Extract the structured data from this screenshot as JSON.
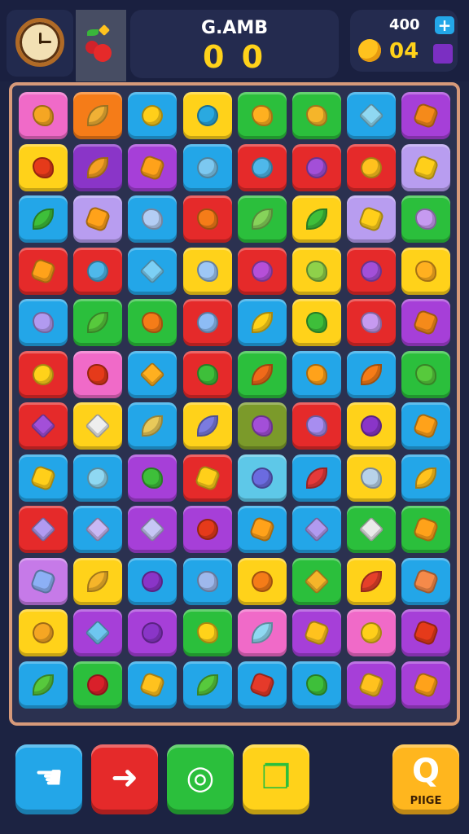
{
  "header": {
    "title": "G.AMB",
    "score": "0 0",
    "coins": "400",
    "plus": "+",
    "gems": "04"
  },
  "icons": {
    "clock": "clock-icon",
    "powerup": "cherries-icon",
    "coin": "coin-icon",
    "gem": "gem-icon"
  },
  "board": {
    "rows": [
      [
        {
          "bg": "#f06ac8",
          "fg": "#f5a623",
          "shape": "blob"
        },
        {
          "bg": "#f57c18",
          "fg": "#f0b035",
          "shape": "leaf"
        },
        {
          "bg": "#23a6e8",
          "fg": "#ffcf1a",
          "shape": "circle"
        },
        {
          "bg": "#ffd21a",
          "fg": "#2aa9e0",
          "shape": "circle"
        },
        {
          "bg": "#2bbf3c",
          "fg": "#ffb020",
          "shape": "blob"
        },
        {
          "bg": "#2bbf3c",
          "fg": "#f5b52a",
          "shape": "blob"
        },
        {
          "bg": "#23a6e8",
          "fg": "#8fd8f2",
          "shape": "diamond"
        },
        {
          "bg": "#a63fd8",
          "fg": "#f58a1a",
          "shape": "star"
        }
      ],
      [
        {
          "bg": "#ffd21a",
          "fg": "#e53a1a",
          "shape": "blob"
        },
        {
          "bg": "#8a35c8",
          "fg": "#f5a023",
          "shape": "leaf"
        },
        {
          "bg": "#a63fd8",
          "fg": "#ffa21a",
          "shape": "star"
        },
        {
          "bg": "#23a6e8",
          "fg": "#7cc8f0",
          "shape": "circle"
        },
        {
          "bg": "#e52a2a",
          "fg": "#4fb8ea",
          "shape": "circle"
        },
        {
          "bg": "#e52a2a",
          "fg": "#a34fd8",
          "shape": "circle"
        },
        {
          "bg": "#e52a2a",
          "fg": "#ffc21e",
          "shape": "circle"
        },
        {
          "bg": "#b89df0",
          "fg": "#ffcf1a",
          "shape": "star"
        }
      ],
      [
        {
          "bg": "#23a6e8",
          "fg": "#3ebf3a",
          "shape": "leaf"
        },
        {
          "bg": "#b89df0",
          "fg": "#ffa21a",
          "shape": "star"
        },
        {
          "bg": "#23a6e8",
          "fg": "#b3cdf5",
          "shape": "blob"
        },
        {
          "bg": "#e52a2a",
          "fg": "#f57c18",
          "shape": "blob"
        },
        {
          "bg": "#2bbf3c",
          "fg": "#86d35a",
          "shape": "leaf"
        },
        {
          "bg": "#ffd21a",
          "fg": "#3ebf3a",
          "shape": "leaf"
        },
        {
          "bg": "#b89df0",
          "fg": "#ffcf1a",
          "shape": "star"
        },
        {
          "bg": "#2bbf3c",
          "fg": "#c69af0",
          "shape": "blob"
        }
      ],
      [
        {
          "bg": "#e52a2a",
          "fg": "#ffa21a",
          "shape": "star"
        },
        {
          "bg": "#e52a2a",
          "fg": "#4fb8ea",
          "shape": "circle"
        },
        {
          "bg": "#23a6e8",
          "fg": "#7cd0f5",
          "shape": "diamond"
        },
        {
          "bg": "#ffd21a",
          "fg": "#9ec7f5",
          "shape": "blob"
        },
        {
          "bg": "#e52a2a",
          "fg": "#b64fd8",
          "shape": "circle"
        },
        {
          "bg": "#ffd21a",
          "fg": "#8fd14a",
          "shape": "blob"
        },
        {
          "bg": "#e52a2a",
          "fg": "#a34fd8",
          "shape": "circle"
        },
        {
          "bg": "#ffd21a",
          "fg": "#ffb020",
          "shape": "blob"
        }
      ],
      [
        {
          "bg": "#23a6e8",
          "fg": "#b19af0",
          "shape": "blob"
        },
        {
          "bg": "#2bbf3c",
          "fg": "#57c93c",
          "shape": "leaf"
        },
        {
          "bg": "#2bbf3c",
          "fg": "#f57c18",
          "shape": "blob"
        },
        {
          "bg": "#e52a2a",
          "fg": "#8dbcf5",
          "shape": "circle"
        },
        {
          "bg": "#23a6e8",
          "fg": "#ffd21a",
          "shape": "leaf"
        },
        {
          "bg": "#ffd21a",
          "fg": "#3ebf3a",
          "shape": "blob"
        },
        {
          "bg": "#e52a2a",
          "fg": "#c69af0",
          "shape": "blob"
        },
        {
          "bg": "#a63fd8",
          "fg": "#f58a1a",
          "shape": "star"
        }
      ],
      [
        {
          "bg": "#e52a2a",
          "fg": "#ffd21a",
          "shape": "circle"
        },
        {
          "bg": "#f06ac8",
          "fg": "#e53a1a",
          "shape": "blob"
        },
        {
          "bg": "#23a6e8",
          "fg": "#ffb020",
          "shape": "diamond"
        },
        {
          "bg": "#e52a2a",
          "fg": "#3ebf3a",
          "shape": "blob"
        },
        {
          "bg": "#2bbf3c",
          "fg": "#f06a1a",
          "shape": "leaf"
        },
        {
          "bg": "#23a6e8",
          "fg": "#ffa21a",
          "shape": "blob"
        },
        {
          "bg": "#23a6e8",
          "fg": "#f57c18",
          "shape": "leaf"
        },
        {
          "bg": "#2bbf3c",
          "fg": "#57c93c",
          "shape": "blob"
        }
      ],
      [
        {
          "bg": "#e52a2a",
          "fg": "#a34fd8",
          "shape": "diamond"
        },
        {
          "bg": "#ffd21a",
          "fg": "#eeeeee",
          "shape": "diamond"
        },
        {
          "bg": "#23a6e8",
          "fg": "#e8c95a",
          "shape": "leaf"
        },
        {
          "bg": "#ffd21a",
          "fg": "#7b7be0",
          "shape": "leaf"
        },
        {
          "bg": "#7b9a2a",
          "fg": "#a34fd8",
          "shape": "blob"
        },
        {
          "bg": "#e52a2a",
          "fg": "#a78df0",
          "shape": "blob"
        },
        {
          "bg": "#ffd21a",
          "fg": "#8a35c8",
          "shape": "circle"
        },
        {
          "bg": "#23a6e8",
          "fg": "#ffa21a",
          "shape": "star"
        }
      ],
      [
        {
          "bg": "#23a6e8",
          "fg": "#ffcf1a",
          "shape": "star"
        },
        {
          "bg": "#23a6e8",
          "fg": "#8fd8f2",
          "shape": "circle"
        },
        {
          "bg": "#a63fd8",
          "fg": "#3ebf3a",
          "shape": "blob"
        },
        {
          "bg": "#e52a2a",
          "fg": "#ffcf1a",
          "shape": "star"
        },
        {
          "bg": "#5ec8e8",
          "fg": "#6b6be0",
          "shape": "circle"
        },
        {
          "bg": "#23a6e8",
          "fg": "#e53a3a",
          "shape": "leaf"
        },
        {
          "bg": "#ffd21a",
          "fg": "#b8d2e8",
          "shape": "blob"
        },
        {
          "bg": "#23a6e8",
          "fg": "#ffc21e",
          "shape": "leaf"
        }
      ],
      [
        {
          "bg": "#e52a2a",
          "fg": "#b19af0",
          "shape": "diamond"
        },
        {
          "bg": "#23a6e8",
          "fg": "#c9b8f5",
          "shape": "diamond"
        },
        {
          "bg": "#a63fd8",
          "fg": "#c6c6f5",
          "shape": "diamond"
        },
        {
          "bg": "#a63fd8",
          "fg": "#e53a1a",
          "shape": "circle"
        },
        {
          "bg": "#23a6e8",
          "fg": "#ffa21a",
          "shape": "star"
        },
        {
          "bg": "#23a6e8",
          "fg": "#b19af0",
          "shape": "diamond"
        },
        {
          "bg": "#2bbf3c",
          "fg": "#eaeaea",
          "shape": "diamond"
        },
        {
          "bg": "#2bbf3c",
          "fg": "#ffa21a",
          "shape": "star"
        }
      ],
      [
        {
          "bg": "#c67ae8",
          "fg": "#8cb0f5",
          "shape": "star"
        },
        {
          "bg": "#ffd21a",
          "fg": "#f5b52a",
          "shape": "leaf"
        },
        {
          "bg": "#23a6e8",
          "fg": "#8a35c8",
          "shape": "circle"
        },
        {
          "bg": "#23a6e8",
          "fg": "#9eb8ec",
          "shape": "blob"
        },
        {
          "bg": "#ffd21a",
          "fg": "#f57c18",
          "shape": "circle"
        },
        {
          "bg": "#2bbf3c",
          "fg": "#f5b52a",
          "shape": "diamond"
        },
        {
          "bg": "#ffd21a",
          "fg": "#e5402a",
          "shape": "leaf"
        },
        {
          "bg": "#23a6e8",
          "fg": "#f58a4a",
          "shape": "star"
        }
      ],
      [
        {
          "bg": "#ffd21a",
          "fg": "#f5a623",
          "shape": "circle"
        },
        {
          "bg": "#a63fd8",
          "fg": "#6ec6f0",
          "shape": "diamond"
        },
        {
          "bg": "#a63fd8",
          "fg": "#8a35c8",
          "shape": "circle"
        },
        {
          "bg": "#2bbf3c",
          "fg": "#ffd21a",
          "shape": "blob"
        },
        {
          "bg": "#f06ac8",
          "fg": "#8fd8f2",
          "shape": "leaf"
        },
        {
          "bg": "#a63fd8",
          "fg": "#ffc21e",
          "shape": "star"
        },
        {
          "bg": "#f06ac8",
          "fg": "#ffcf1a",
          "shape": "circle"
        },
        {
          "bg": "#a63fd8",
          "fg": "#e53a1a",
          "shape": "star"
        }
      ],
      [
        {
          "bg": "#23a6e8",
          "fg": "#57c93c",
          "shape": "leaf"
        },
        {
          "bg": "#2bbf3c",
          "fg": "#d9202a",
          "shape": "circle"
        },
        {
          "bg": "#23a6e8",
          "fg": "#ffc21e",
          "shape": "star"
        },
        {
          "bg": "#23a6e8",
          "fg": "#57c93c",
          "shape": "leaf"
        },
        {
          "bg": "#23a6e8",
          "fg": "#e53a2a",
          "shape": "star"
        },
        {
          "bg": "#23a6e8",
          "fg": "#3ebf3a",
          "shape": "blob"
        },
        {
          "bg": "#a63fd8",
          "fg": "#ffc21e",
          "shape": "star"
        },
        {
          "bg": "#a63fd8",
          "fg": "#ffa21a",
          "shape": "star"
        }
      ]
    ]
  },
  "actions": [
    {
      "name": "hint-button",
      "bg": "#23a6e8",
      "glyph": "☚",
      "icon": "glove-icon"
    },
    {
      "name": "swap-button",
      "bg": "#e52a2a",
      "glyph": "➜",
      "icon": "arrow-icon"
    },
    {
      "name": "bomb-button",
      "bg": "#2bbf3c",
      "glyph": "◎",
      "icon": "target-icon"
    },
    {
      "name": "shuffle-button",
      "bg": "#ffd21a",
      "glyph": "❐",
      "icon": "box-icon"
    }
  ],
  "pause": {
    "label": "PIIGE",
    "glyph": "Q",
    "bg": "#ffb61e"
  }
}
